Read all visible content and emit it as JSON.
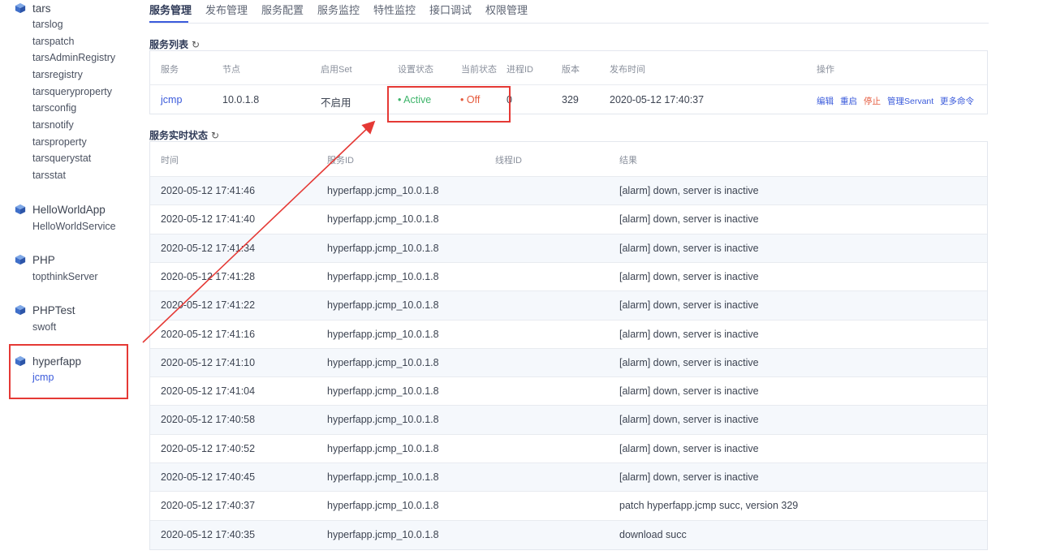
{
  "sidebar": {
    "apps": [
      {
        "name": "tars",
        "services": [
          "tarslog",
          "tarspatch",
          "tarsAdminRegistry",
          "tarsregistry",
          "tarsqueryproperty",
          "tarsconfig",
          "tarsnotify",
          "tarsproperty",
          "tarsquerystat",
          "tarsstat"
        ]
      },
      {
        "name": "HelloWorldApp",
        "services": [
          "HelloWorldService"
        ]
      },
      {
        "name": "PHP",
        "services": [
          "topthinkServer"
        ]
      },
      {
        "name": "PHPTest",
        "services": [
          "swoft"
        ]
      },
      {
        "name": "hyperfapp",
        "services": [
          "jcmp"
        ]
      }
    ],
    "icon": "cube-icon"
  },
  "tabs": [
    "服务管理",
    "发布管理",
    "服务配置",
    "服务监控",
    "特性监控",
    "接口调试",
    "权限管理"
  ],
  "service_list": {
    "title": "服务列表",
    "headers": [
      "服务",
      "节点",
      "启用Set",
      "设置状态",
      "当前状态",
      "进程ID",
      "版本",
      "发布时间",
      "操作"
    ],
    "row": {
      "service": "jcmp",
      "node": "10.0.1.8",
      "set": "不启用",
      "setting_state": "• Active",
      "current_state": "• Off",
      "pid": "0",
      "version": "329",
      "publish_time": "2020-05-12 17:40:37",
      "ops": [
        "编辑",
        "重启",
        "停止",
        "管理Servant",
        "更多命令"
      ]
    }
  },
  "realtime": {
    "title": "服务实时状态",
    "headers": [
      "时间",
      "服务ID",
      "线程ID",
      "结果"
    ],
    "rows": [
      [
        "2020-05-12 17:41:46",
        "hyperfapp.jcmp_10.0.1.8",
        "",
        "[alarm] down, server is inactive"
      ],
      [
        "2020-05-12 17:41:40",
        "hyperfapp.jcmp_10.0.1.8",
        "",
        "[alarm] down, server is inactive"
      ],
      [
        "2020-05-12 17:41:34",
        "hyperfapp.jcmp_10.0.1.8",
        "",
        "[alarm] down, server is inactive"
      ],
      [
        "2020-05-12 17:41:28",
        "hyperfapp.jcmp_10.0.1.8",
        "",
        "[alarm] down, server is inactive"
      ],
      [
        "2020-05-12 17:41:22",
        "hyperfapp.jcmp_10.0.1.8",
        "",
        "[alarm] down, server is inactive"
      ],
      [
        "2020-05-12 17:41:16",
        "hyperfapp.jcmp_10.0.1.8",
        "",
        "[alarm] down, server is inactive"
      ],
      [
        "2020-05-12 17:41:10",
        "hyperfapp.jcmp_10.0.1.8",
        "",
        "[alarm] down, server is inactive"
      ],
      [
        "2020-05-12 17:41:04",
        "hyperfapp.jcmp_10.0.1.8",
        "",
        "[alarm] down, server is inactive"
      ],
      [
        "2020-05-12 17:40:58",
        "hyperfapp.jcmp_10.0.1.8",
        "",
        "[alarm] down, server is inactive"
      ],
      [
        "2020-05-12 17:40:52",
        "hyperfapp.jcmp_10.0.1.8",
        "",
        "[alarm] down, server is inactive"
      ],
      [
        "2020-05-12 17:40:45",
        "hyperfapp.jcmp_10.0.1.8",
        "",
        "[alarm] down, server is inactive"
      ],
      [
        "2020-05-12 17:40:37",
        "hyperfapp.jcmp_10.0.1.8",
        "",
        "patch hyperfapp.jcmp succ, version 329"
      ],
      [
        "2020-05-12 17:40:35",
        "hyperfapp.jcmp_10.0.1.8",
        "",
        "download succ"
      ]
    ]
  },
  "colors": {
    "accent": "#3b5bdb",
    "active": "#3fb56b",
    "off": "#e55a3c",
    "annotation": "#e53935"
  }
}
